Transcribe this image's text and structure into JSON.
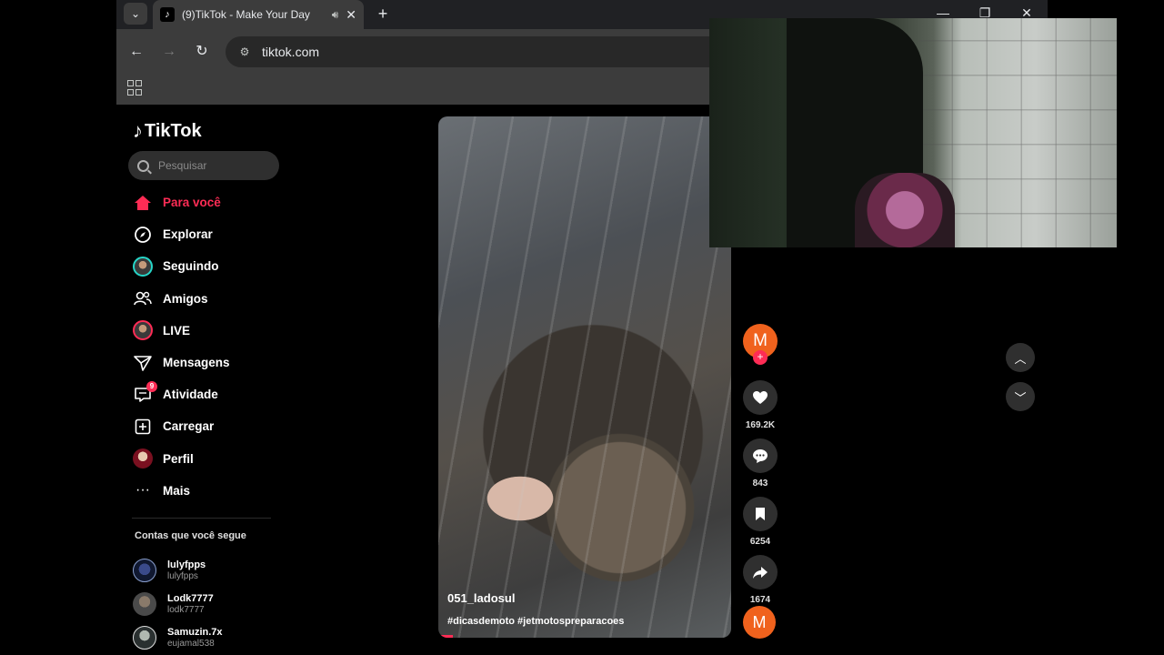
{
  "browser": {
    "tab": {
      "title": "(9)TikTok - Make Your Day",
      "favicon": "tiktok-icon"
    },
    "url": "tiktok.com",
    "window_controls": {
      "minimize": "—",
      "restore": "❐",
      "close": "✕"
    }
  },
  "app": {
    "logo_text": "TikTok",
    "search_placeholder": "Pesquisar",
    "nav": [
      {
        "label": "Para você",
        "icon": "home-icon",
        "active": true
      },
      {
        "label": "Explorar",
        "icon": "compass-icon"
      },
      {
        "label": "Seguindo",
        "icon": "following-avatar"
      },
      {
        "label": "Amigos",
        "icon": "friends-icon"
      },
      {
        "label": "LIVE",
        "icon": "live-avatar"
      },
      {
        "label": "Mensagens",
        "icon": "send-icon"
      },
      {
        "label": "Atividade",
        "icon": "inbox-icon",
        "badge": "9"
      },
      {
        "label": "Carregar",
        "icon": "upload-icon"
      },
      {
        "label": "Perfil",
        "icon": "profile-avatar"
      },
      {
        "label": "Mais",
        "icon": "more-icon"
      }
    ],
    "following_title": "Contas que você segue",
    "following": [
      {
        "name": "lulyfpps",
        "handle": "lulyfpps"
      },
      {
        "name": "Lodk7777",
        "handle": "lodk7777"
      },
      {
        "name": "Samuzin.7x",
        "handle": "eujamal538"
      }
    ]
  },
  "video": {
    "author": "051_ladosul",
    "tags": "#dicasdemoto #jetmotospreparacoes",
    "progress": 0.05
  },
  "actions": {
    "author_initial": "M",
    "likes": "169.2K",
    "comments": "843",
    "saves": "6254",
    "shares": "1674",
    "music_initial": "M"
  },
  "colors": {
    "accent": "#fe2c55",
    "avatar": "#f0621d"
  }
}
